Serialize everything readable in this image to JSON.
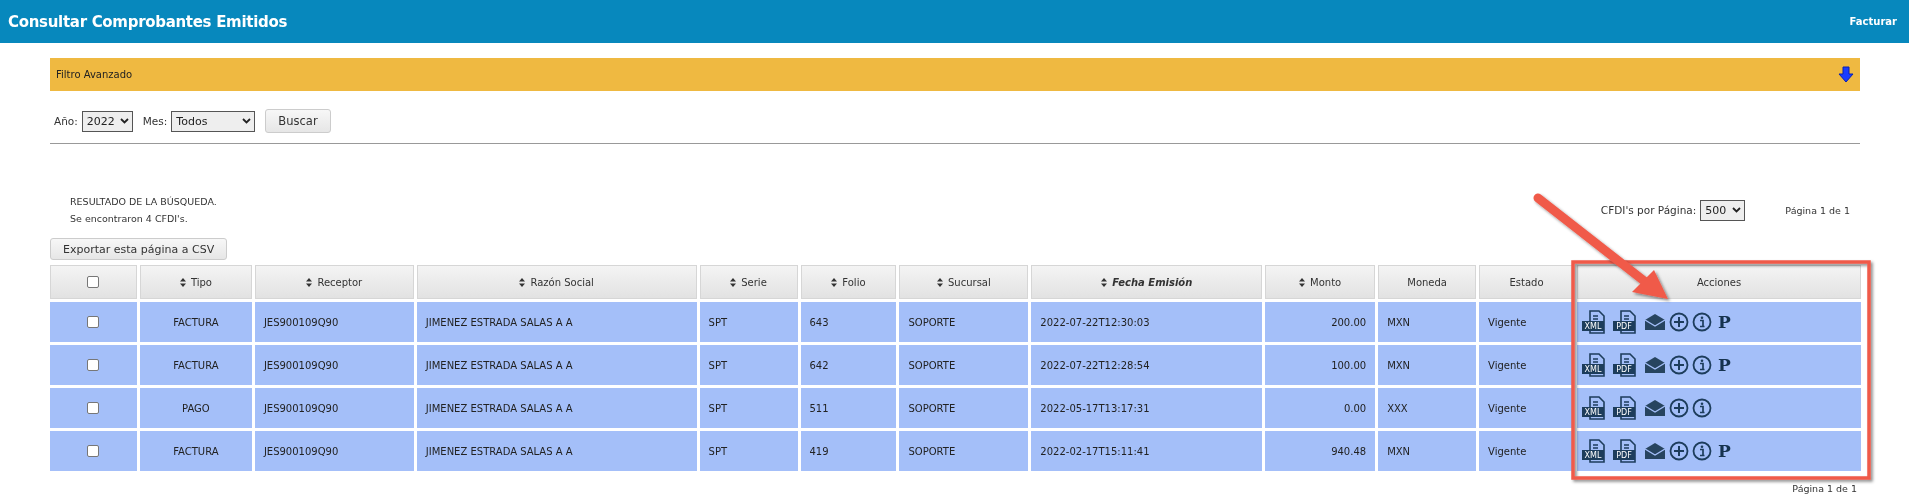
{
  "header": {
    "title": "Consultar Comprobantes Emitidos",
    "link": "Facturar"
  },
  "filter": {
    "title": "Filtro Avanzado",
    "expanded": false,
    "year_label": "Año:",
    "year": "2022",
    "month_label": "Mes:",
    "month": "Todos",
    "search_button": "Buscar"
  },
  "results": {
    "heading": "RESULTADO DE LA BÚSQUEDA.",
    "count": "Se encontraron 4 CFDI's.",
    "per_page_label": "CFDI's por Página:",
    "per_page": "500",
    "page_info": "Página 1 de 1",
    "export_button": "Exportar esta página a CSV"
  },
  "table": {
    "select_all": {
      "checked": false
    },
    "columns": [
      {
        "kind": "center",
        "label": "Tipo",
        "sortable": true,
        "sorted": false
      },
      {
        "kind": "text",
        "label": "Receptor",
        "sortable": true,
        "sorted": false
      },
      {
        "kind": "text",
        "label": "Razón Social",
        "sortable": true,
        "sorted": false
      },
      {
        "kind": "text",
        "label": "Serie",
        "sortable": true,
        "sorted": false
      },
      {
        "kind": "text",
        "label": "Folio",
        "sortable": true,
        "sorted": false
      },
      {
        "kind": "text",
        "label": "Sucursal",
        "sortable": true,
        "sorted": false
      },
      {
        "kind": "text",
        "label": "Fecha Emisión",
        "sortable": true,
        "sorted": true
      },
      {
        "kind": "number",
        "label": "Monto",
        "sortable": true,
        "sorted": false
      },
      {
        "kind": "text",
        "label": "Moneda",
        "sortable": false,
        "sorted": false
      },
      {
        "kind": "text",
        "label": "Estado",
        "sortable": false,
        "sorted": false
      },
      {
        "kind": "actions",
        "label": "Acciones",
        "sortable": false,
        "sorted": false
      }
    ],
    "rows": [
      {
        "checked": false,
        "cells": [
          "FACTURA",
          "JES900109Q90",
          "JIMENEZ ESTRADA SALAS A A",
          "SPT",
          "643",
          "SOPORTE",
          "2022-07-22T12:30:03",
          "200.00",
          "MXN",
          "Vigente"
        ],
        "actions": [
          {
            "kind": "file",
            "label": "XML"
          },
          {
            "kind": "file",
            "label": "PDF"
          },
          {
            "kind": "mail"
          },
          {
            "kind": "add"
          },
          {
            "kind": "info"
          },
          {
            "kind": "letter",
            "label": "P"
          }
        ]
      },
      {
        "checked": false,
        "cells": [
          "FACTURA",
          "JES900109Q90",
          "JIMENEZ ESTRADA SALAS A A",
          "SPT",
          "642",
          "SOPORTE",
          "2022-07-22T12:28:54",
          "100.00",
          "MXN",
          "Vigente"
        ],
        "actions": [
          {
            "kind": "file",
            "label": "XML"
          },
          {
            "kind": "file",
            "label": "PDF"
          },
          {
            "kind": "mail"
          },
          {
            "kind": "add"
          },
          {
            "kind": "info"
          },
          {
            "kind": "letter",
            "label": "P"
          }
        ]
      },
      {
        "checked": false,
        "cells": [
          "PAGO",
          "JES900109Q90",
          "JIMENEZ ESTRADA SALAS A A",
          "SPT",
          "511",
          "SOPORTE",
          "2022-05-17T13:17:31",
          "0.00",
          "XXX",
          "Vigente"
        ],
        "actions": [
          {
            "kind": "file",
            "label": "XML"
          },
          {
            "kind": "file",
            "label": "PDF"
          },
          {
            "kind": "mail"
          },
          {
            "kind": "add"
          },
          {
            "kind": "info"
          }
        ]
      },
      {
        "checked": false,
        "cells": [
          "FACTURA",
          "JES900109Q90",
          "JIMENEZ ESTRADA SALAS A A",
          "SPT",
          "419",
          "SOPORTE",
          "2022-02-17T15:11:41",
          "940.48",
          "MXN",
          "Vigente"
        ],
        "actions": [
          {
            "kind": "file",
            "label": "XML"
          },
          {
            "kind": "file",
            "label": "PDF"
          },
          {
            "kind": "mail"
          },
          {
            "kind": "add"
          },
          {
            "kind": "info"
          },
          {
            "kind": "letter",
            "label": "P"
          }
        ]
      }
    ]
  },
  "footer": {
    "page_info": "Página 1 de 1"
  }
}
